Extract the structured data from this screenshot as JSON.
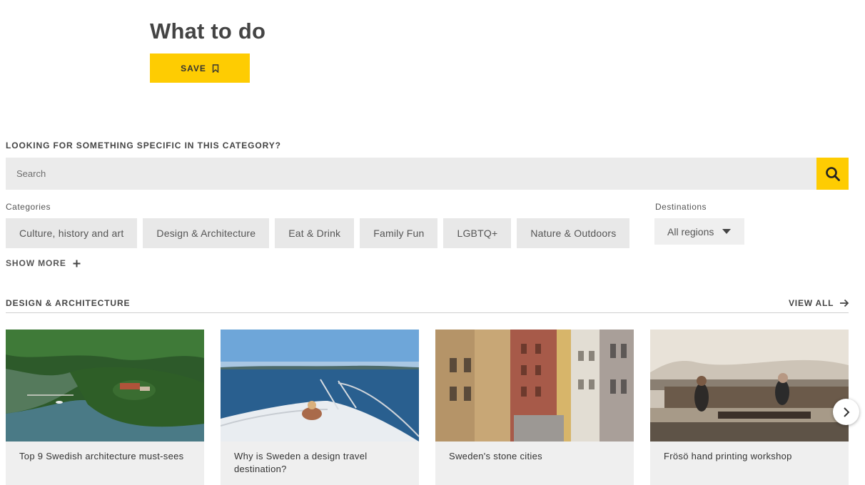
{
  "header": {
    "title": "What to do",
    "save_label": "SAVE",
    "save_icon": "bookmark-icon"
  },
  "search": {
    "label": "LOOKING FOR SOMETHING SPECIFIC IN THIS CATEGORY?",
    "placeholder": "Search",
    "value": "",
    "icon": "search-icon"
  },
  "filters": {
    "categories_label": "Categories",
    "categories": [
      {
        "label": "Culture, history and art"
      },
      {
        "label": "Design & Architecture"
      },
      {
        "label": "Eat & Drink"
      },
      {
        "label": "Family Fun"
      },
      {
        "label": "LGBTQ+"
      },
      {
        "label": "Nature & Outdoors"
      }
    ],
    "show_more_label": "SHOW MORE",
    "destinations_label": "Destinations",
    "destination_selected": "All regions"
  },
  "section": {
    "title": "DESIGN & ARCHITECTURE",
    "view_all_label": "VIEW ALL",
    "cards": [
      {
        "title": "Top 9 Swedish architecture must-sees"
      },
      {
        "title": "Why is Sweden a design travel destination?"
      },
      {
        "title": "Sweden's stone cities"
      },
      {
        "title": "Frösö hand printing workshop"
      }
    ]
  },
  "colors": {
    "accent": "#fecc02",
    "chip_bg": "#e8e8e8",
    "card_bg": "#efefef",
    "text": "#3c3c3c"
  }
}
